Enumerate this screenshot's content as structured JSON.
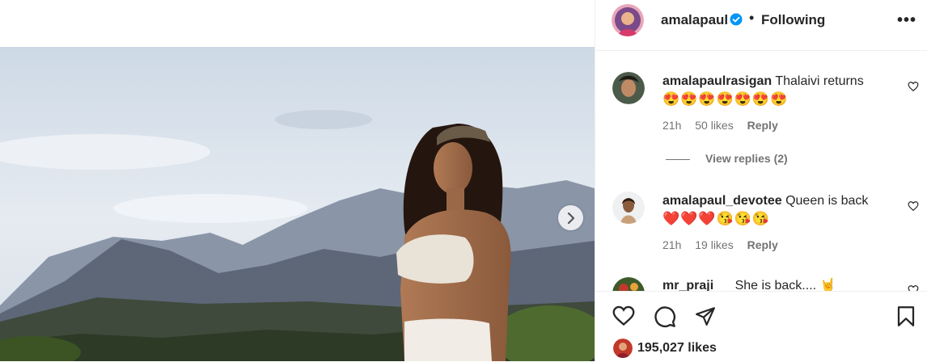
{
  "post": {
    "username": "amalapaul",
    "follow_status": "Following",
    "separator": "•",
    "more": "•••",
    "likes": "195,027 likes"
  },
  "comments": [
    {
      "username": "amalapaulrasigan",
      "text": "Thalaivi returns",
      "emojis": "😍😍😍😍😍😍😍",
      "time": "21h",
      "likes": "50 likes",
      "reply": "Reply"
    },
    {
      "username": "amalapaul_devotee",
      "text": "Queen is back",
      "emojis": "❤️❤️❤️😘😘😘",
      "time": "21h",
      "likes": "19 likes",
      "reply": "Reply"
    },
    {
      "username": "mr_praji",
      "text": "She is back.... 🤘"
    }
  ],
  "view_replies": "View replies (2)",
  "icons": {
    "verified": "verified-badge-icon",
    "next": "chevron-right-icon",
    "like": "heart-icon",
    "comment": "comment-icon",
    "share": "send-icon",
    "save": "bookmark-icon",
    "more": "more-options-icon"
  },
  "colors": {
    "verified": "#0095f6",
    "text": "#262626",
    "muted": "#737373"
  }
}
